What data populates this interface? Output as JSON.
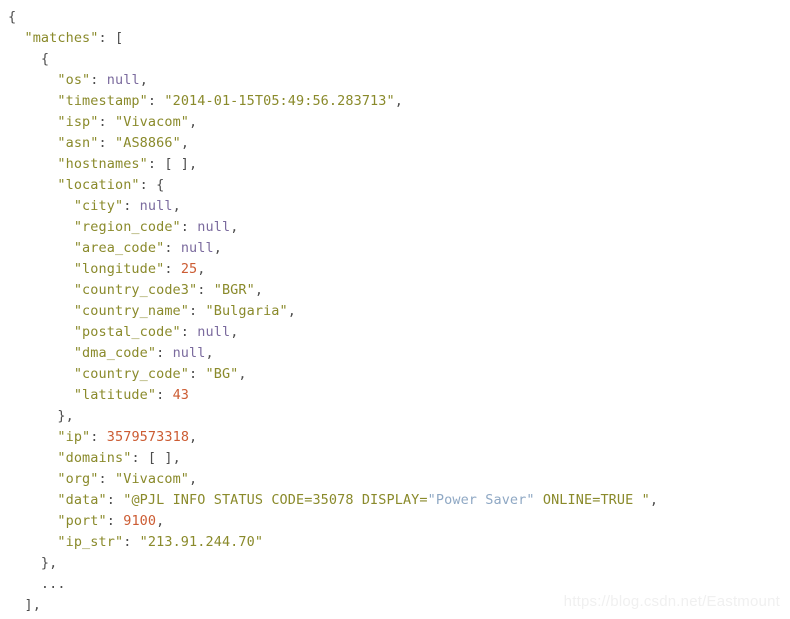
{
  "viewer": {
    "title": "Shodan API JSON response",
    "background": "#ffffff",
    "colors": {
      "punctuation": "#4d4d4d",
      "key": "#8a8a2b",
      "string": "#8a8a2b",
      "number": "#cc5c33",
      "null": "#7b6b9e",
      "inner_string": "#8fa8c4",
      "watermark": "#f0f0f0"
    }
  },
  "watermark": {
    "text": "https://blog.csdn.net/Eastmount"
  },
  "code": {
    "lines": [
      {
        "indent": 0,
        "tokens": [
          {
            "t": "{",
            "c": "punct"
          }
        ]
      },
      {
        "indent": 1,
        "tokens": [
          {
            "t": "\"matches\"",
            "c": "key"
          },
          {
            "t": ": [",
            "c": "punct"
          }
        ]
      },
      {
        "indent": 2,
        "tokens": [
          {
            "t": "{",
            "c": "punct"
          }
        ]
      },
      {
        "indent": 3,
        "tokens": [
          {
            "t": "\"os\"",
            "c": "key"
          },
          {
            "t": ": ",
            "c": "punct"
          },
          {
            "t": "null",
            "c": "null"
          },
          {
            "t": ",",
            "c": "punct"
          }
        ]
      },
      {
        "indent": 3,
        "tokens": [
          {
            "t": "\"timestamp\"",
            "c": "key"
          },
          {
            "t": ": ",
            "c": "punct"
          },
          {
            "t": "\"2014-01-15T05:49:56.283713\"",
            "c": "string"
          },
          {
            "t": ",",
            "c": "punct"
          }
        ]
      },
      {
        "indent": 3,
        "tokens": [
          {
            "t": "\"isp\"",
            "c": "key"
          },
          {
            "t": ": ",
            "c": "punct"
          },
          {
            "t": "\"Vivacom\"",
            "c": "string"
          },
          {
            "t": ",",
            "c": "punct"
          }
        ]
      },
      {
        "indent": 3,
        "tokens": [
          {
            "t": "\"asn\"",
            "c": "key"
          },
          {
            "t": ": ",
            "c": "punct"
          },
          {
            "t": "\"AS8866\"",
            "c": "string"
          },
          {
            "t": ",",
            "c": "punct"
          }
        ]
      },
      {
        "indent": 3,
        "tokens": [
          {
            "t": "\"hostnames\"",
            "c": "key"
          },
          {
            "t": ": [ ],",
            "c": "punct"
          }
        ]
      },
      {
        "indent": 3,
        "tokens": [
          {
            "t": "\"location\"",
            "c": "key"
          },
          {
            "t": ": {",
            "c": "punct"
          }
        ]
      },
      {
        "indent": 4,
        "tokens": [
          {
            "t": "\"city\"",
            "c": "key"
          },
          {
            "t": ": ",
            "c": "punct"
          },
          {
            "t": "null",
            "c": "null"
          },
          {
            "t": ",",
            "c": "punct"
          }
        ]
      },
      {
        "indent": 4,
        "tokens": [
          {
            "t": "\"region_code\"",
            "c": "key"
          },
          {
            "t": ": ",
            "c": "punct"
          },
          {
            "t": "null",
            "c": "null"
          },
          {
            "t": ",",
            "c": "punct"
          }
        ]
      },
      {
        "indent": 4,
        "tokens": [
          {
            "t": "\"area_code\"",
            "c": "key"
          },
          {
            "t": ": ",
            "c": "punct"
          },
          {
            "t": "null",
            "c": "null"
          },
          {
            "t": ",",
            "c": "punct"
          }
        ]
      },
      {
        "indent": 4,
        "tokens": [
          {
            "t": "\"longitude\"",
            "c": "key"
          },
          {
            "t": ": ",
            "c": "punct"
          },
          {
            "t": "25",
            "c": "number"
          },
          {
            "t": ",",
            "c": "punct"
          }
        ]
      },
      {
        "indent": 4,
        "tokens": [
          {
            "t": "\"country_code3\"",
            "c": "key"
          },
          {
            "t": ": ",
            "c": "punct"
          },
          {
            "t": "\"BGR\"",
            "c": "string"
          },
          {
            "t": ",",
            "c": "punct"
          }
        ]
      },
      {
        "indent": 4,
        "tokens": [
          {
            "t": "\"country_name\"",
            "c": "key"
          },
          {
            "t": ": ",
            "c": "punct"
          },
          {
            "t": "\"Bulgaria\"",
            "c": "string"
          },
          {
            "t": ",",
            "c": "punct"
          }
        ]
      },
      {
        "indent": 4,
        "tokens": [
          {
            "t": "\"postal_code\"",
            "c": "key"
          },
          {
            "t": ": ",
            "c": "punct"
          },
          {
            "t": "null",
            "c": "null"
          },
          {
            "t": ",",
            "c": "punct"
          }
        ]
      },
      {
        "indent": 4,
        "tokens": [
          {
            "t": "\"dma_code\"",
            "c": "key"
          },
          {
            "t": ": ",
            "c": "punct"
          },
          {
            "t": "null",
            "c": "null"
          },
          {
            "t": ",",
            "c": "punct"
          }
        ]
      },
      {
        "indent": 4,
        "tokens": [
          {
            "t": "\"country_code\"",
            "c": "key"
          },
          {
            "t": ": ",
            "c": "punct"
          },
          {
            "t": "\"BG\"",
            "c": "string"
          },
          {
            "t": ",",
            "c": "punct"
          }
        ]
      },
      {
        "indent": 4,
        "tokens": [
          {
            "t": "\"latitude\"",
            "c": "key"
          },
          {
            "t": ": ",
            "c": "punct"
          },
          {
            "t": "43",
            "c": "number"
          }
        ]
      },
      {
        "indent": 3,
        "tokens": [
          {
            "t": "},",
            "c": "punct"
          }
        ]
      },
      {
        "indent": 3,
        "tokens": [
          {
            "t": "\"ip\"",
            "c": "key"
          },
          {
            "t": ": ",
            "c": "punct"
          },
          {
            "t": "3579573318",
            "c": "number"
          },
          {
            "t": ",",
            "c": "punct"
          }
        ]
      },
      {
        "indent": 3,
        "tokens": [
          {
            "t": "\"domains\"",
            "c": "key"
          },
          {
            "t": ": [ ],",
            "c": "punct"
          }
        ]
      },
      {
        "indent": 3,
        "tokens": [
          {
            "t": "\"org\"",
            "c": "key"
          },
          {
            "t": ": ",
            "c": "punct"
          },
          {
            "t": "\"Vivacom\"",
            "c": "string"
          },
          {
            "t": ",",
            "c": "punct"
          }
        ]
      },
      {
        "indent": 3,
        "tokens": [
          {
            "t": "\"data\"",
            "c": "key"
          },
          {
            "t": ": ",
            "c": "punct"
          },
          {
            "t": "\"@PJL INFO STATUS CODE=35078 DISPLAY=",
            "c": "string"
          },
          {
            "t": "\"Power Saver\"",
            "c": "inner"
          },
          {
            "t": " ONLINE=TRUE \"",
            "c": "string"
          },
          {
            "t": ",",
            "c": "punct"
          }
        ]
      },
      {
        "indent": 3,
        "tokens": [
          {
            "t": "\"port\"",
            "c": "key"
          },
          {
            "t": ": ",
            "c": "punct"
          },
          {
            "t": "9100",
            "c": "number"
          },
          {
            "t": ",",
            "c": "punct"
          }
        ]
      },
      {
        "indent": 3,
        "tokens": [
          {
            "t": "\"ip_str\"",
            "c": "key"
          },
          {
            "t": ": ",
            "c": "punct"
          },
          {
            "t": "\"213.91.244.70\"",
            "c": "string"
          }
        ]
      },
      {
        "indent": 2,
        "tokens": [
          {
            "t": "},",
            "c": "punct"
          }
        ]
      },
      {
        "indent": 2,
        "tokens": [
          {
            "t": "...",
            "c": "punct"
          }
        ]
      },
      {
        "indent": 1,
        "tokens": [
          {
            "t": "],",
            "c": "punct"
          }
        ]
      }
    ]
  }
}
